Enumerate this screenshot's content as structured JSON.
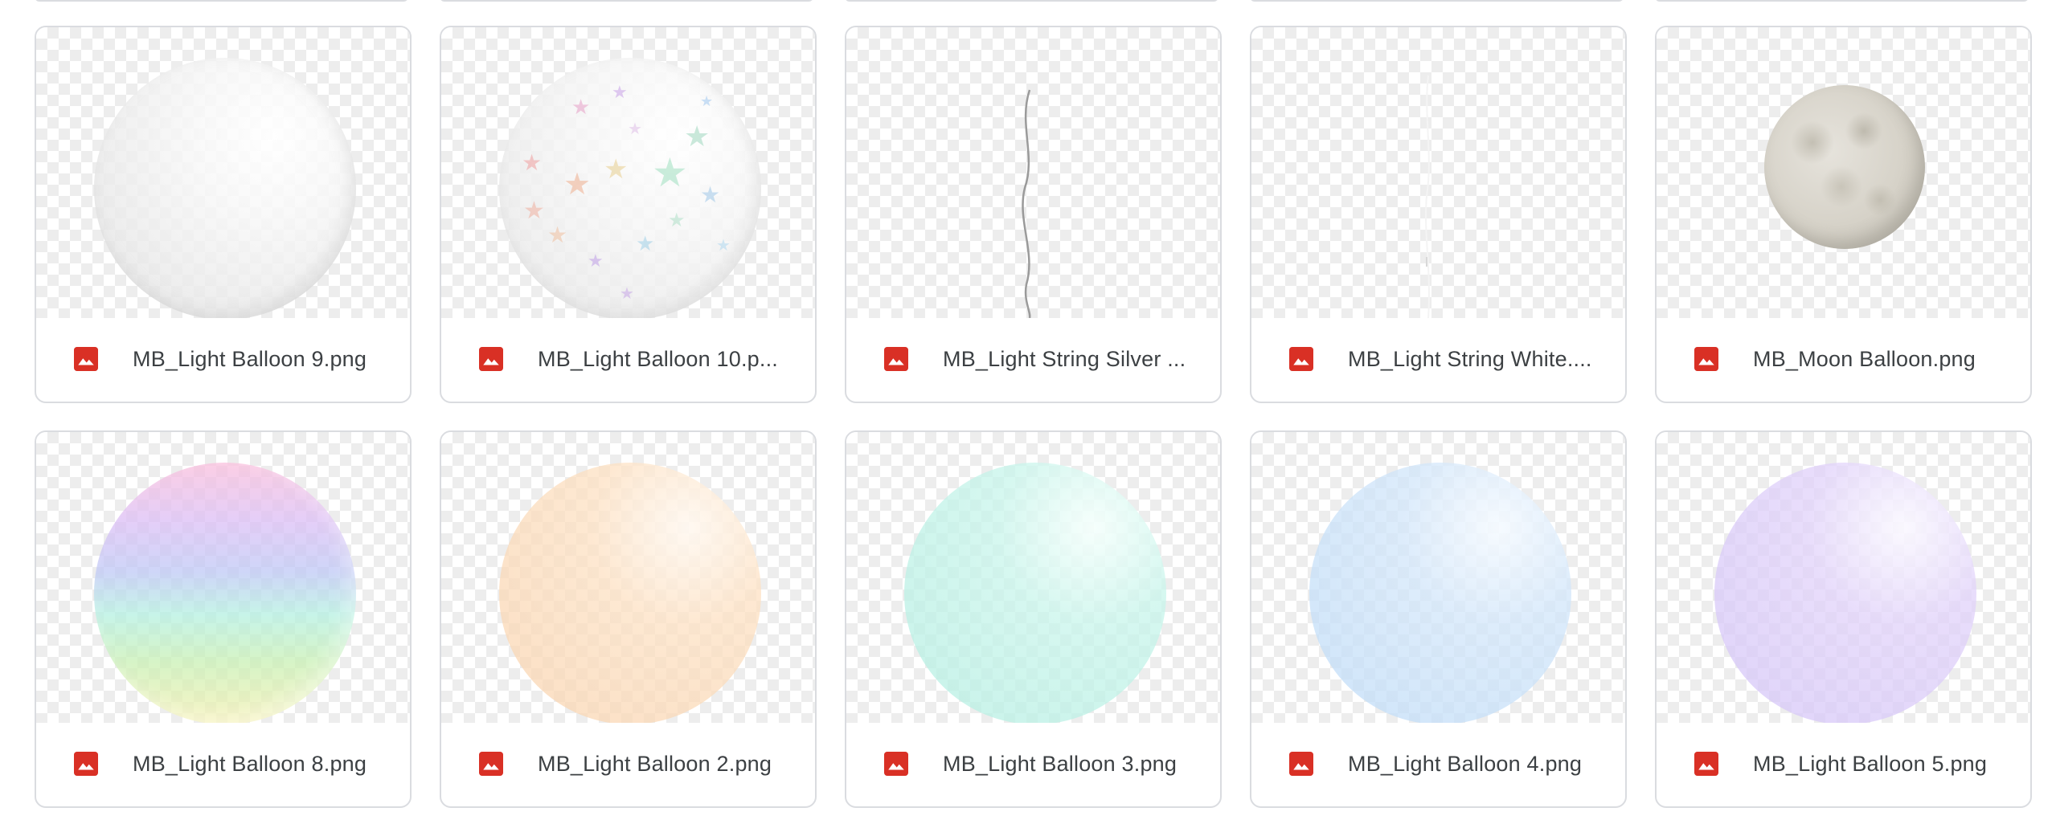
{
  "files": [
    {
      "name": "MB_Light Balloon 9.png",
      "display": "MB_Light Balloon 9.png",
      "thumb": "plain-white"
    },
    {
      "name": "MB_Light Balloon 10.png",
      "display": "MB_Light Balloon 10.p...",
      "thumb": "stars"
    },
    {
      "name": "MB_Light String Silver",
      "display": "MB_Light String Silver ...",
      "thumb": "string-silver"
    },
    {
      "name": "MB_Light String White",
      "display": "MB_Light String White....",
      "thumb": "string-white"
    },
    {
      "name": "MB_Moon Balloon.png",
      "display": "MB_Moon Balloon.png",
      "thumb": "moon"
    },
    {
      "name": "MB_Light Balloon 8.png",
      "display": "MB_Light Balloon 8.png",
      "thumb": "rainbow"
    },
    {
      "name": "MB_Light Balloon 2.png",
      "display": "MB_Light Balloon 2.png",
      "thumb": "peach"
    },
    {
      "name": "MB_Light Balloon 3.png",
      "display": "MB_Light Balloon 3.png",
      "thumb": "mint"
    },
    {
      "name": "MB_Light Balloon 4.png",
      "display": "MB_Light Balloon 4.png",
      "thumb": "sky"
    },
    {
      "name": "MB_Light Balloon 5.png",
      "display": "MB_Light Balloon 5.png",
      "thumb": "lavender"
    }
  ],
  "icons": {
    "file_type": "image-file-icon"
  },
  "colors": {
    "image_icon": "#d93025",
    "border": "#dadce0",
    "text": "#3c4043"
  }
}
